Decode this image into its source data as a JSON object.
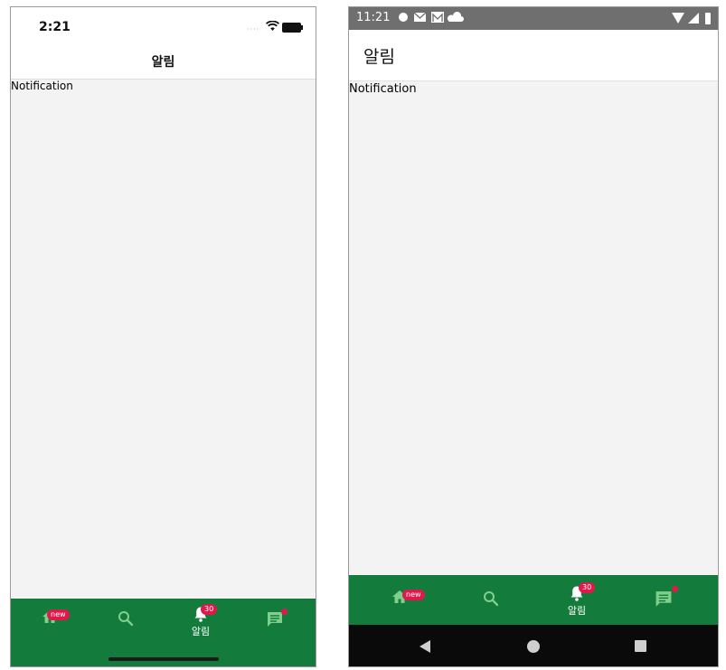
{
  "ios": {
    "status_time": "2:21",
    "nav_title": "알림",
    "content_text": "Notification",
    "tabs": [
      {
        "icon": "home-icon",
        "badge": "new"
      },
      {
        "icon": "search-icon"
      },
      {
        "icon": "bell-icon",
        "label": "알림",
        "badge": "30",
        "active": true
      },
      {
        "icon": "chat-icon",
        "dot": true
      }
    ]
  },
  "android": {
    "status_time": "11:21",
    "app_title": "알림",
    "content_text": "Notification",
    "tabs": [
      {
        "icon": "home-icon",
        "badge": "new"
      },
      {
        "icon": "search-icon"
      },
      {
        "icon": "bell-icon",
        "label": "알림",
        "badge": "30",
        "active": true
      },
      {
        "icon": "chat-icon",
        "dot": true
      }
    ],
    "system_nav": [
      "back-icon",
      "home-circle-icon",
      "recents-square-icon"
    ]
  },
  "colors": {
    "tabbar_green": "#137c3c",
    "inactive_icon": "#7fd08a",
    "badge_red": "#e0194c",
    "content_bg": "#f3f3f3"
  }
}
